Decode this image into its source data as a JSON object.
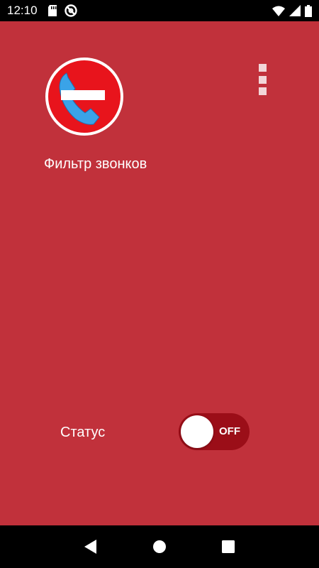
{
  "status_bar": {
    "time": "12:10",
    "icons": [
      "sd-card-icon",
      "do-not-disturb-icon",
      "wifi-icon",
      "signal-icon",
      "battery-icon"
    ]
  },
  "app": {
    "title": "Фильтр звонков",
    "status_label": "Статус",
    "toggle": {
      "label": "OFF",
      "state": "off"
    },
    "menu_icon": "overflow-menu-icon",
    "logo_icon": "call-block-icon"
  },
  "nav_bar": {
    "icons": [
      "back-icon",
      "home-icon",
      "recents-icon"
    ]
  },
  "colors": {
    "background": "#c1313b",
    "toggle_track": "#9b0e18",
    "logo_red": "#e8141c",
    "phone_blue": "#3aa3e8"
  }
}
